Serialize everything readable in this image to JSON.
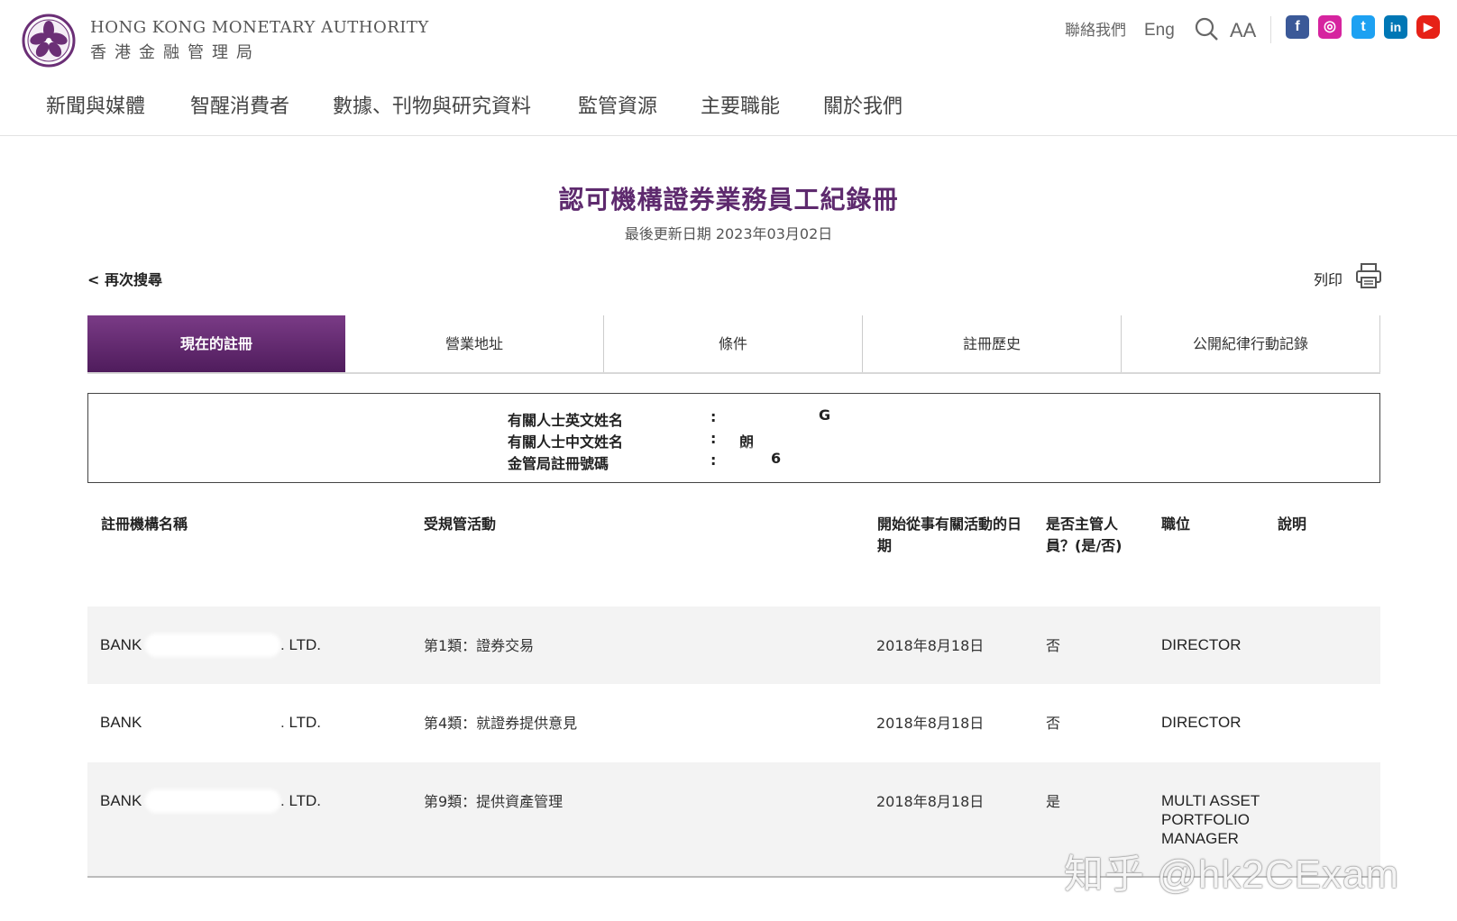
{
  "header": {
    "org_en": "HONG KONG MONETARY AUTHORITY",
    "org_zh": "香港金融管理局",
    "contact": "聯絡我們",
    "lang": "Eng",
    "search_icon": "search-icon",
    "fontsize_label": "AA"
  },
  "social": [
    {
      "name": "facebook",
      "glyph": "f",
      "color": "#3b5998"
    },
    {
      "name": "instagram",
      "glyph": "◎",
      "color": "#d6249f"
    },
    {
      "name": "twitter",
      "glyph": "t",
      "color": "#1da1f2"
    },
    {
      "name": "linkedin",
      "glyph": "in",
      "color": "#0077b5"
    },
    {
      "name": "youtube",
      "glyph": "▶",
      "color": "#e62117"
    }
  ],
  "nav": [
    "新聞與媒體",
    "智醒消費者",
    "數據、刊物與研究資料",
    "監管資源",
    "主要職能",
    "關於我們"
  ],
  "page": {
    "title": "認可機構證券業務員工紀錄冊",
    "updated": "最後更新日期 2023年03月02日",
    "back": "< 再次搜尋",
    "print": "列印"
  },
  "tabs": [
    "現在的註冊",
    "營業地址",
    "條件",
    "註冊歷史",
    "公開紀律行動記錄"
  ],
  "info": {
    "labels": [
      "有關人士英文姓名",
      "有關人士中文姓名",
      "金管局註冊號碼"
    ],
    "colons": [
      ":",
      ":",
      ":"
    ],
    "values": [
      "G",
      "朗",
      "6"
    ]
  },
  "table": {
    "headers": {
      "institution": "註冊機構名稱",
      "activity": "受規管活動",
      "start_date": "開始從事有關活動的日期",
      "exec_officer": "是否主管人員？(是/否)",
      "position": "職位",
      "remarks": "說明"
    },
    "rows": [
      {
        "bank_prefix": "BANK",
        "bank_suffix": ". LTD.",
        "activity": "第1類：證券交易",
        "date": "2018年8月18日",
        "exec": "否",
        "position": "DIRECTOR"
      },
      {
        "bank_prefix": "BANK",
        "bank_suffix": ". LTD.",
        "activity": "第4類：就證券提供意見",
        "date": "2018年8月18日",
        "exec": "否",
        "position": "DIRECTOR"
      },
      {
        "bank_prefix": "BANK",
        "bank_suffix": ". LTD.",
        "activity": "第9類：提供資產管理",
        "date": "2018年8月18日",
        "exec": "是",
        "position": "MULTI ASSET PORTFOLIO MANAGER"
      }
    ]
  },
  "watermark": "知乎 @hk2CExam"
}
